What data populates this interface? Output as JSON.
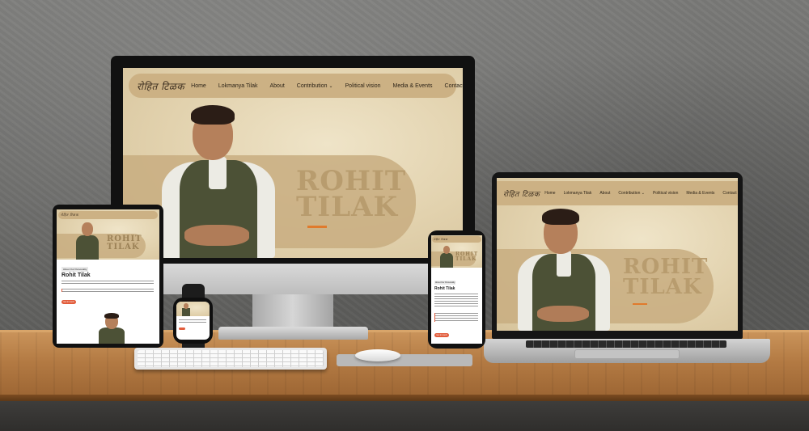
{
  "site": {
    "logo_text": "रोहित टिळक",
    "hero_name_line1": "ROHIT",
    "hero_name_line2": "TILAK",
    "menu": [
      {
        "label": "Home"
      },
      {
        "label": "Lokmanya Tilak"
      },
      {
        "label": "About"
      },
      {
        "label": "Contribution"
      },
      {
        "label": "Political vision"
      },
      {
        "label": "Media & Events"
      },
      {
        "label": "Contact"
      }
    ],
    "contribution_caret": "⌄"
  },
  "mobile": {
    "about_tag": "About Our Personality",
    "about_title": "Rohit Tilak",
    "cta_label": "Get in touch"
  },
  "colors": {
    "accent": "#e07a2c",
    "nav_bg": "#ccb184",
    "button": "#e25c3b"
  }
}
